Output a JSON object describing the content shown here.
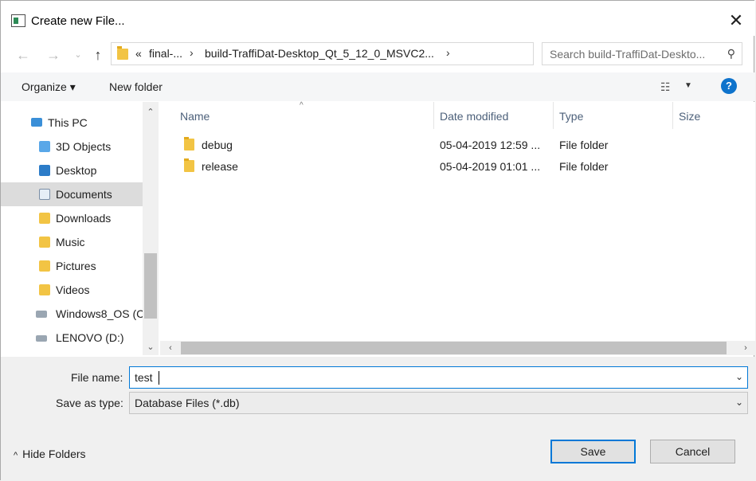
{
  "window": {
    "title": "Create new File...",
    "close": "✕"
  },
  "address": {
    "crumbs": [
      "«",
      "final-...",
      "build-TraffiDat-Desktop_Qt_5_12_0_MSVC2...",
      "›"
    ],
    "search_placeholder": "Search build-TraffiDat-Deskto..."
  },
  "toolbar": {
    "organize": "Organize ▾",
    "new_folder": "New folder",
    "help": "?"
  },
  "nav": {
    "items": [
      {
        "label": "This PC",
        "icon": "pc-icon"
      },
      {
        "label": "3D Objects",
        "icon": "objects3d-icon"
      },
      {
        "label": "Desktop",
        "icon": "desktop-icon"
      },
      {
        "label": "Documents",
        "icon": "documents-icon",
        "selected": true
      },
      {
        "label": "Downloads",
        "icon": "downloads-icon"
      },
      {
        "label": "Music",
        "icon": "music-icon"
      },
      {
        "label": "Pictures",
        "icon": "pictures-icon"
      },
      {
        "label": "Videos",
        "icon": "videos-icon"
      },
      {
        "label": "Windows8_OS (C",
        "icon": "drive-c-icon"
      },
      {
        "label": "LENOVO (D:)",
        "icon": "drive-d-icon"
      }
    ]
  },
  "files": {
    "columns": [
      "Name",
      "Date modified",
      "Type",
      "Size"
    ],
    "rows": [
      {
        "name": "debug",
        "date": "05-04-2019 12:59 ...",
        "type": "File folder"
      },
      {
        "name": "release",
        "date": "05-04-2019 01:01 ...",
        "type": "File folder"
      }
    ]
  },
  "form": {
    "filename_label": "File name:",
    "filename_value": "test",
    "type_label": "Save as type:",
    "type_value": "Database Files (*.db)"
  },
  "footer": {
    "hide_folders": "Hide Folders",
    "save": "Save",
    "cancel": "Cancel"
  },
  "colors": {
    "accent": "#0078d7",
    "folder": "#f2c444",
    "selected_nav": "#dcdcdc",
    "help": "#0e73cc"
  }
}
